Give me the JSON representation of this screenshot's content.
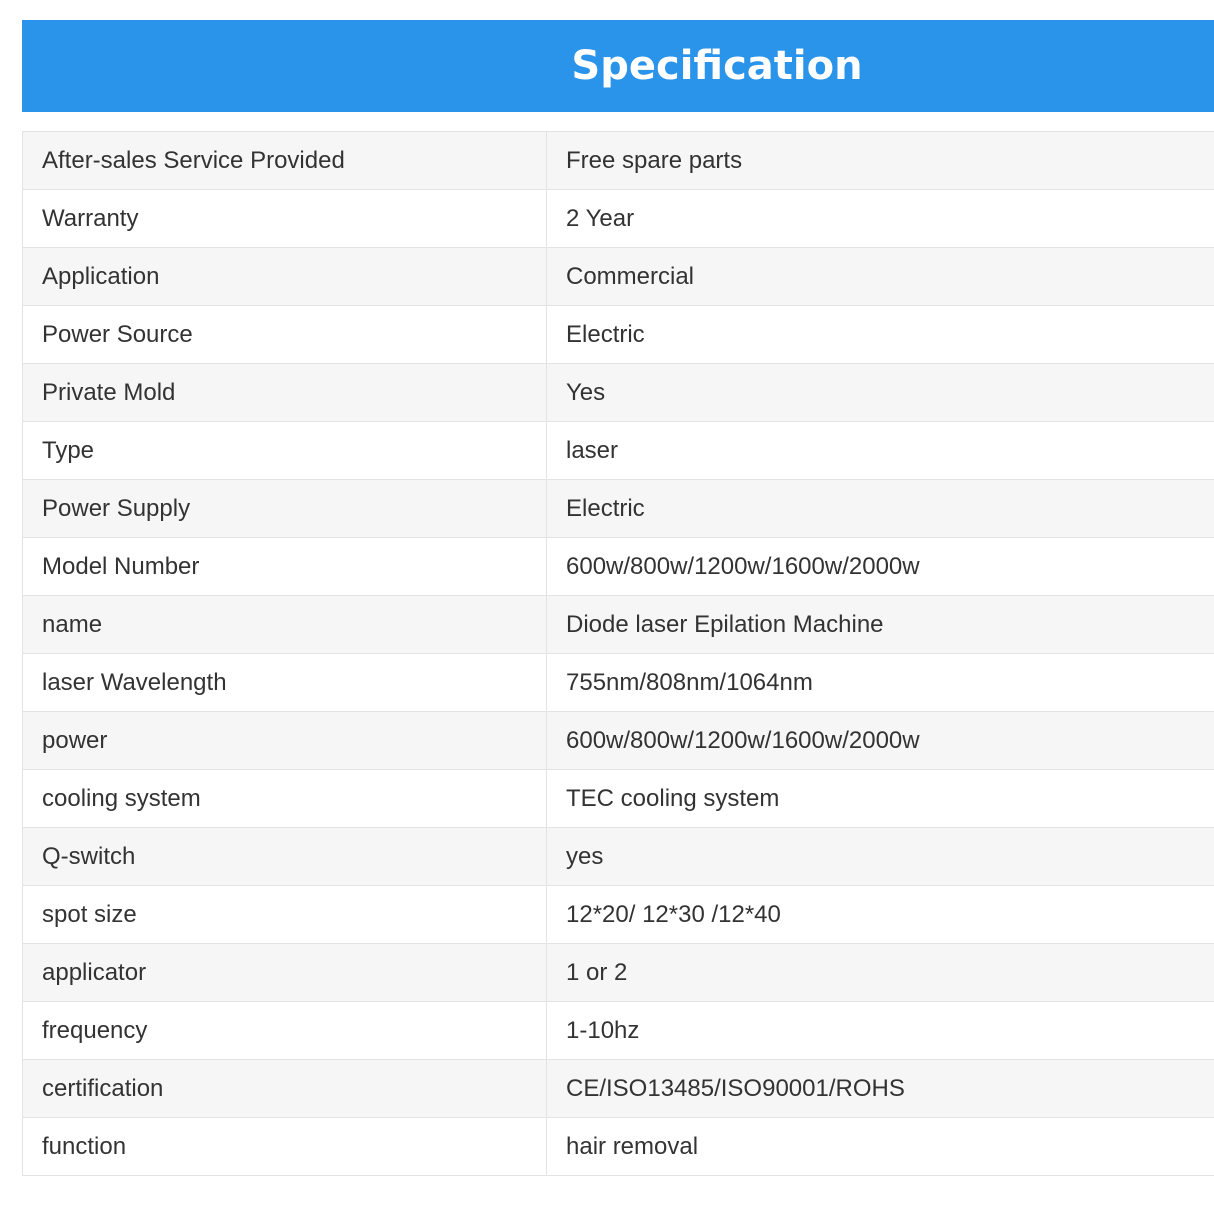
{
  "header": {
    "title": "Specification",
    "color": "#2a93ea"
  },
  "specs": [
    {
      "key": "After-sales Service Provided",
      "value": "Free spare parts"
    },
    {
      "key": "Warranty",
      "value": "2 Year"
    },
    {
      "key": "Application",
      "value": "Commercial"
    },
    {
      "key": "Power Source",
      "value": "Electric"
    },
    {
      "key": "Private Mold",
      "value": "Yes"
    },
    {
      "key": "Type",
      "value": "laser"
    },
    {
      "key": "Power Supply",
      "value": "Electric"
    },
    {
      "key": "Model Number",
      "value": "600w/800w/1200w/1600w/2000w"
    },
    {
      "key": "name",
      "value": "Diode laser Epilation Machine"
    },
    {
      "key": "laser Wavelength",
      "value": "755nm/808nm/1064nm"
    },
    {
      "key": "power",
      "value": "600w/800w/1200w/1600w/2000w"
    },
    {
      "key": "cooling system",
      "value": "TEC cooling system"
    },
    {
      "key": "Q-switch",
      "value": "yes"
    },
    {
      "key": "spot size",
      "value": "12*20/ 12*30 /12*40"
    },
    {
      "key": "applicator",
      "value": "1 or 2"
    },
    {
      "key": "frequency",
      "value": "1-10hz"
    },
    {
      "key": "certification",
      "value": "CE/ISO13485/ISO90001/ROHS"
    },
    {
      "key": "function",
      "value": "hair removal"
    }
  ]
}
